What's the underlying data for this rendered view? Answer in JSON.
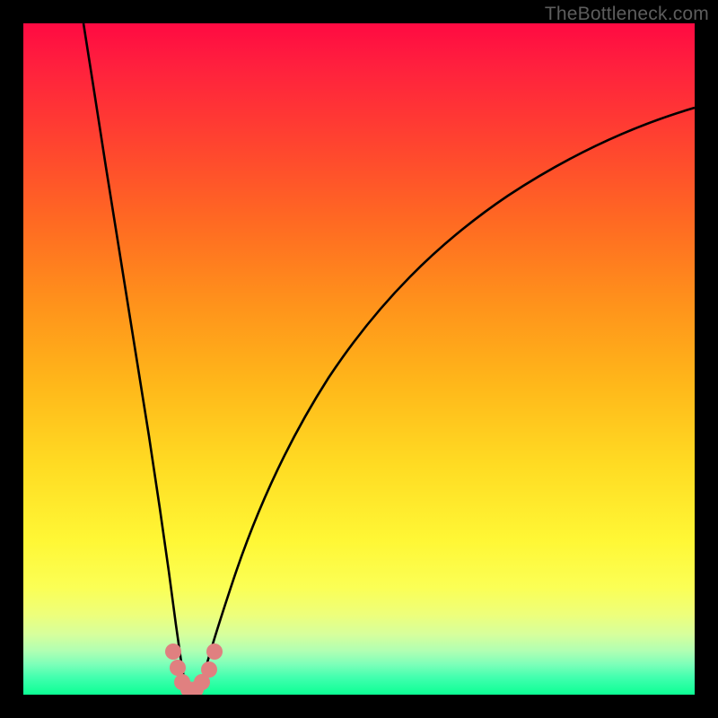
{
  "watermark": "TheBottleneck.com",
  "colors": {
    "gradient_top": "#ff0a42",
    "gradient_bottom": "#0cff94",
    "curve_stroke": "#000000",
    "marker": "#e08080",
    "frame": "#000000"
  },
  "chart_data": {
    "type": "line",
    "title": "",
    "xlabel": "",
    "ylabel": "",
    "xlim": [
      0,
      100
    ],
    "ylim": [
      0,
      100
    ],
    "grid": false,
    "series": [
      {
        "name": "left-branch",
        "x": [
          9,
          10,
          12,
          14,
          16,
          18,
          20,
          21,
          22,
          22.8,
          23.4,
          24
        ],
        "y": [
          100,
          90,
          74,
          60,
          46,
          33,
          20,
          13,
          8,
          4,
          1.5,
          0
        ]
      },
      {
        "name": "right-branch",
        "x": [
          26,
          27,
          29,
          32,
          36,
          41,
          48,
          56,
          66,
          78,
          90,
          100
        ],
        "y": [
          0,
          3,
          9,
          17,
          28,
          39,
          50,
          60,
          69,
          77,
          83,
          87
        ]
      }
    ],
    "markers": {
      "name": "highlight-points",
      "x": [
        22.2,
        22.8,
        23.4,
        24.2,
        25.0,
        25.8,
        27.0,
        28.0
      ],
      "y": [
        6.5,
        3.5,
        1.5,
        0.8,
        0.8,
        1.5,
        3.0,
        6.5
      ]
    },
    "background": {
      "type": "vertical-gradient",
      "meaning": "red(top)=bad / green(bottom)=good"
    }
  }
}
